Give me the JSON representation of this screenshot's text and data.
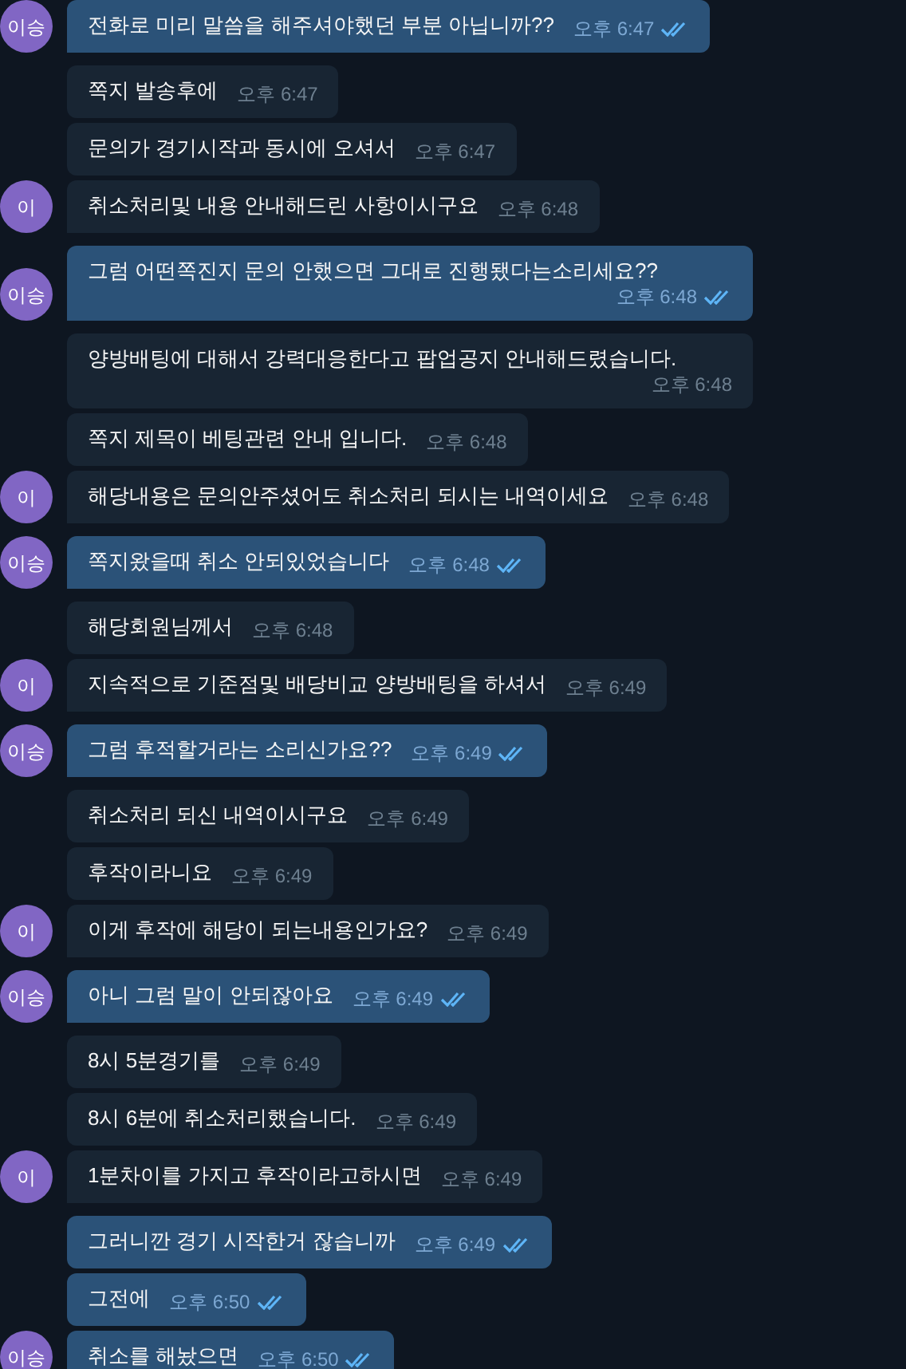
{
  "messages": [
    {
      "kind": "outgoing",
      "text": "전화로 미리 말씀을 해주셔야했던 부분 아닙니까??",
      "time": "오후 6:47",
      "read": true,
      "avatar": "이승"
    },
    {
      "kind": "incoming",
      "text": "쪽지 발송후에",
      "time": "오후 6:47"
    },
    {
      "kind": "incoming",
      "text": "문의가 경기시작과 동시에 오셔서",
      "time": "오후 6:47"
    },
    {
      "kind": "incoming",
      "text": "취소처리및 내용 안내해드린 사항이시구요",
      "time": "오후 6:48",
      "avatar": "이"
    },
    {
      "kind": "outgoing",
      "text": "그럼 어떤쪽진지 문의 안했으면 그대로 진행됐다는소리세요??",
      "time": "오후 6:48",
      "read": true,
      "avatar": "이승"
    },
    {
      "kind": "incoming",
      "text": "양방배팅에 대해서 강력대응한다고 팝업공지 안내해드렸습니다.",
      "time": "오후 6:48"
    },
    {
      "kind": "incoming",
      "text": "쪽지 제목이 베팅관련 안내 입니다.",
      "time": "오후 6:48"
    },
    {
      "kind": "incoming",
      "text": "해당내용은 문의안주셨어도 취소처리 되시는 내역이세요",
      "time": "오후 6:48",
      "avatar": "이"
    },
    {
      "kind": "outgoing",
      "text": "쪽지왔을때 취소 안되있었습니다",
      "time": "오후 6:48",
      "read": true,
      "avatar": "이승"
    },
    {
      "kind": "incoming",
      "text": "해당회원님께서",
      "time": "오후 6:48"
    },
    {
      "kind": "incoming",
      "text": "지속적으로 기준점및 배당비교 양방배팅을 하셔서",
      "time": "오후 6:49",
      "avatar": "이"
    },
    {
      "kind": "outgoing",
      "text": "그럼 후적할거라는 소리신가요??",
      "time": "오후 6:49",
      "read": true,
      "avatar": "이승"
    },
    {
      "kind": "incoming",
      "text": "취소처리 되신 내역이시구요",
      "time": "오후 6:49"
    },
    {
      "kind": "incoming",
      "text": "후작이라니요",
      "time": "오후 6:49"
    },
    {
      "kind": "incoming",
      "text": "이게 후작에 해당이 되는내용인가요?",
      "time": "오후 6:49",
      "avatar": "이"
    },
    {
      "kind": "outgoing",
      "text": "아니 그럼 말이 안되잖아요",
      "time": "오후 6:49",
      "read": true,
      "avatar": "이승"
    },
    {
      "kind": "incoming",
      "text": "8시 5분경기를",
      "time": "오후 6:49"
    },
    {
      "kind": "incoming",
      "text": "8시 6분에 취소처리했습니다.",
      "time": "오후 6:49"
    },
    {
      "kind": "incoming",
      "text": "1분차이를 가지고 후작이라고하시면",
      "time": "오후 6:49",
      "avatar": "이"
    },
    {
      "kind": "outgoing",
      "text": "그러니깐 경기 시작한거 잖습니까",
      "time": "오후 6:49",
      "read": true
    },
    {
      "kind": "outgoing",
      "text": "그전에",
      "time": "오후 6:50",
      "read": true
    },
    {
      "kind": "outgoing",
      "text": "취소를 해놨으면",
      "time": "오후 6:50",
      "read": true,
      "avatar": "이승"
    }
  ]
}
